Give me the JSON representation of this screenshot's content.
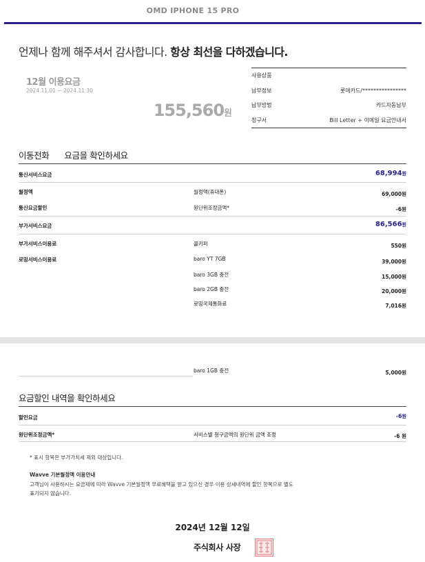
{
  "brand": "OMD IPHONE 15 PRO",
  "greeting": {
    "normal": "언제나 함께 해주셔서 감사합니다. ",
    "bold": "항상 최선을 다하겠습니다."
  },
  "summary": {
    "month_label": "12월 이용요금",
    "period": "2024.11.01 ~ 2024.11.30",
    "total": "155,560",
    "total_unit": "원"
  },
  "info": [
    {
      "label": "사용상품",
      "value": ""
    },
    {
      "label": "납부정보",
      "value": "롯데카드/****************"
    },
    {
      "label": "납부방법",
      "value": "카드자동납부"
    },
    {
      "label": "청구서",
      "value": "Bill Letter + 이메일 요금안내서"
    }
  ],
  "mobile": {
    "title": "이동전화",
    "subtitle": "요금을 확인하세요",
    "telecom": {
      "label": "통신서비스요금",
      "amount": "68,994",
      "unit": "원"
    },
    "monthly": {
      "label": "월정액",
      "item": "월정액(휴대폰)",
      "amount": "69,000원"
    },
    "discount": {
      "label": "통신요금할인",
      "item": "원단위조정금액*",
      "amount": "-6원"
    },
    "addon": {
      "label": "부가서비스요금",
      "amount": "86,566",
      "unit": "원"
    },
    "addon_use": {
      "label": "부가서비스이용료",
      "item": "콜키퍼",
      "amount": "550원"
    },
    "roaming": {
      "label": "로밍서비스이용료",
      "items": [
        {
          "item": "baro YT 7GB",
          "amount": "39,000원"
        },
        {
          "item": "baro 3GB 충전",
          "amount": "15,000원"
        },
        {
          "item": "baro 2GB 충전",
          "amount": "20,000원"
        },
        {
          "item": "로밍국제통화료",
          "amount": "7,016원"
        },
        {
          "item": "baro 1GB 충전",
          "amount": "5,000원"
        }
      ]
    }
  },
  "discounts": {
    "title": "요금할인 내역을 확인하세요",
    "total": {
      "label": "할인요금",
      "amount": "-6",
      "unit": "원"
    },
    "row": {
      "label": "원단위조정금액*",
      "item": "서비스별 청구금액의 원단위 금액 조정",
      "amount": "-6 원"
    }
  },
  "notes": {
    "vat": "* 표시 항목은 부가가치세 제외 대상입니다.",
    "wavve_title": "Wavve 기본월정액 이용안내",
    "wavve_line1": "고객님이 사용하시는 요금제에 따라 Wavve 기본월정액 무료혜택을 받고 있으신 경우 이용 상세내역에 할인 항목으로 별도",
    "wavve_line2": "표기되지 않습니다."
  },
  "footer": {
    "date": "2024년 12월 12일",
    "company": "주식회사 사장"
  },
  "colors": {
    "accent": "#2a1f8c",
    "seal": "#e07a7a"
  }
}
